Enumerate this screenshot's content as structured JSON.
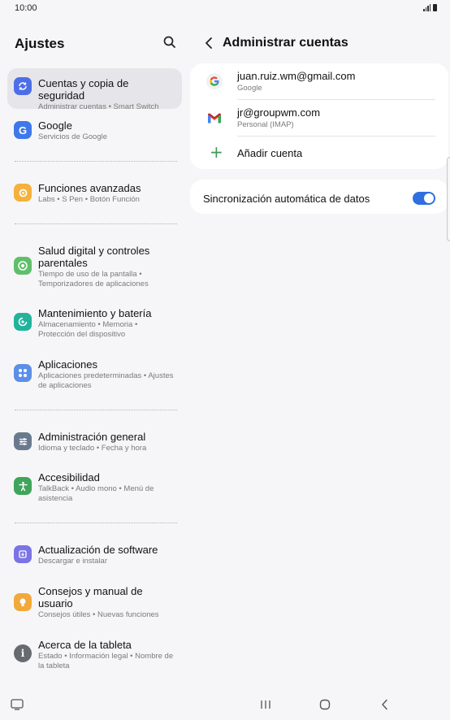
{
  "status": {
    "time": "10:00"
  },
  "left": {
    "header": "Ajustes",
    "items": [
      {
        "title": "Cuentas y copia de seguridad",
        "sub": "Administrar cuentas  •  Smart Switch",
        "icon": "sync-icon",
        "color": "#4d6ee8"
      },
      {
        "title": "Google",
        "sub": "Servicios de Google",
        "icon": "google-icon",
        "color": "#3f78ea"
      },
      {
        "title": "Funciones avanzadas",
        "sub": "Labs  •  S Pen  •  Botón Función",
        "icon": "star-gear-icon",
        "color": "#f4b13c"
      },
      {
        "title": "Salud digital y controles parentales",
        "sub": "Tiempo de uso de la pantalla  •  Temporizadores de aplicaciones",
        "icon": "wellbeing-icon",
        "color": "#5fbf6a"
      },
      {
        "title": "Mantenimiento y batería",
        "sub": "Almacenamiento  •  Memoria  •  Protección del dispositivo",
        "icon": "maintenance-icon",
        "color": "#21b39c"
      },
      {
        "title": "Aplicaciones",
        "sub": "Aplicaciones predeterminadas  •  Ajustes de aplicaciones",
        "icon": "apps-grid-icon",
        "color": "#5b8fe8"
      },
      {
        "title": "Administración general",
        "sub": "Idioma y teclado  •  Fecha y hora",
        "icon": "sliders-icon",
        "color": "#6a7a8e"
      },
      {
        "title": "Accesibilidad",
        "sub": "TalkBack  •  Audio mono  •  Menú de asistencia",
        "icon": "accessibility-icon",
        "color": "#3fa55a"
      },
      {
        "title": "Actualización de software",
        "sub": "Descargar e instalar",
        "icon": "update-icon",
        "color": "#7b74e6"
      },
      {
        "title": "Consejos y manual de usuario",
        "sub": "Consejos útiles  •  Nuevas funciones",
        "icon": "lightbulb-icon",
        "color": "#f2a93b"
      },
      {
        "title": "Acerca de la tableta",
        "sub": "Estado  •  Información legal  •  Nombre de la tableta",
        "icon": "info-icon",
        "color": "#676a70"
      }
    ]
  },
  "right": {
    "title": "Administrar cuentas",
    "accounts": [
      {
        "title": "juan.ruiz.wm@gmail.com",
        "sub": "Google",
        "icon": "google-g-icon"
      },
      {
        "title": "jr@groupwm.com",
        "sub": "Personal (IMAP)",
        "icon": "gmail-icon"
      }
    ],
    "add_account": "Añadir cuenta",
    "sync_label": "Sincronización automática de datos",
    "sync_on": true
  }
}
